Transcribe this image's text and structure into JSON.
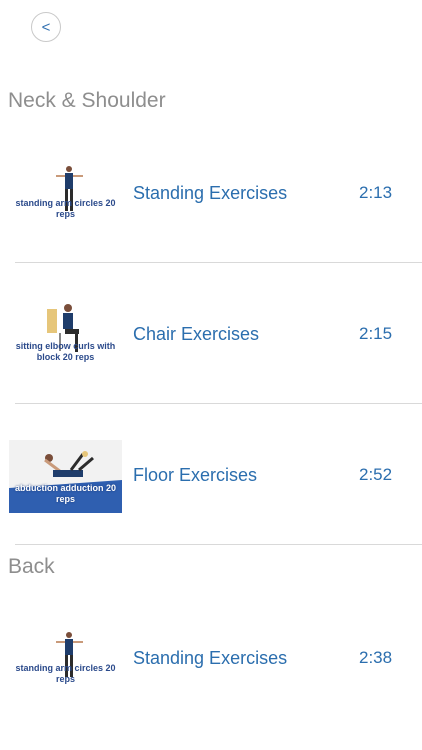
{
  "nav": {
    "back_label": "<"
  },
  "sections": [
    {
      "title": "Neck & Shoulder",
      "items": [
        {
          "title": "Standing Exercises",
          "duration": "2:13",
          "thumb_caption": "standing arm circles 20 reps",
          "thumb_style": "standing"
        },
        {
          "title": "Chair Exercises",
          "duration": "2:15",
          "thumb_caption": "sitting elbow curls with block 20 reps",
          "thumb_style": "chair"
        },
        {
          "title": "Floor Exercises",
          "duration": "2:52",
          "thumb_caption": "abduction adduction 20 reps",
          "thumb_style": "floor"
        }
      ]
    },
    {
      "title": "Back",
      "items": [
        {
          "title": "Standing Exercises",
          "duration": "2:38",
          "thumb_caption": "standing arm circles 20 reps",
          "thumb_style": "standing"
        }
      ]
    }
  ],
  "colors": {
    "link": "#2b6eae",
    "section_title": "#8e8e8e",
    "divider": "#d9d9d9"
  }
}
